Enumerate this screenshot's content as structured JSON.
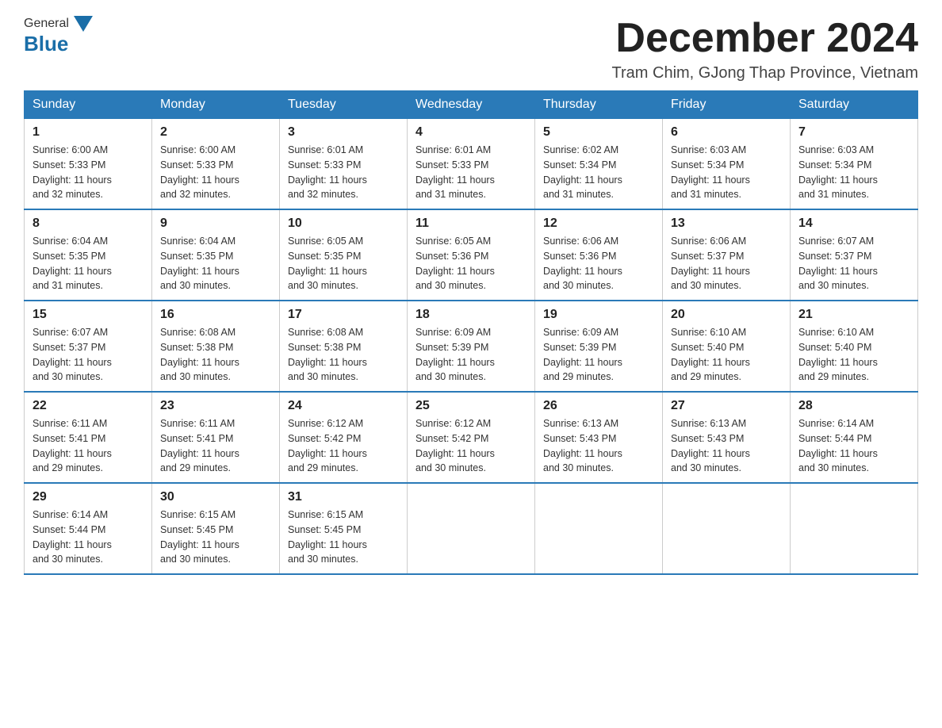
{
  "header": {
    "logo_general": "General",
    "logo_blue": "Blue",
    "month_title": "December 2024",
    "location": "Tram Chim, GJong Thap Province, Vietnam"
  },
  "days_of_week": [
    "Sunday",
    "Monday",
    "Tuesday",
    "Wednesday",
    "Thursday",
    "Friday",
    "Saturday"
  ],
  "weeks": [
    [
      {
        "day": "1",
        "sunrise": "6:00 AM",
        "sunset": "5:33 PM",
        "daylight": "11 hours and 32 minutes."
      },
      {
        "day": "2",
        "sunrise": "6:00 AM",
        "sunset": "5:33 PM",
        "daylight": "11 hours and 32 minutes."
      },
      {
        "day": "3",
        "sunrise": "6:01 AM",
        "sunset": "5:33 PM",
        "daylight": "11 hours and 32 minutes."
      },
      {
        "day": "4",
        "sunrise": "6:01 AM",
        "sunset": "5:33 PM",
        "daylight": "11 hours and 31 minutes."
      },
      {
        "day": "5",
        "sunrise": "6:02 AM",
        "sunset": "5:34 PM",
        "daylight": "11 hours and 31 minutes."
      },
      {
        "day": "6",
        "sunrise": "6:03 AM",
        "sunset": "5:34 PM",
        "daylight": "11 hours and 31 minutes."
      },
      {
        "day": "7",
        "sunrise": "6:03 AM",
        "sunset": "5:34 PM",
        "daylight": "11 hours and 31 minutes."
      }
    ],
    [
      {
        "day": "8",
        "sunrise": "6:04 AM",
        "sunset": "5:35 PM",
        "daylight": "11 hours and 31 minutes."
      },
      {
        "day": "9",
        "sunrise": "6:04 AM",
        "sunset": "5:35 PM",
        "daylight": "11 hours and 30 minutes."
      },
      {
        "day": "10",
        "sunrise": "6:05 AM",
        "sunset": "5:35 PM",
        "daylight": "11 hours and 30 minutes."
      },
      {
        "day": "11",
        "sunrise": "6:05 AM",
        "sunset": "5:36 PM",
        "daylight": "11 hours and 30 minutes."
      },
      {
        "day": "12",
        "sunrise": "6:06 AM",
        "sunset": "5:36 PM",
        "daylight": "11 hours and 30 minutes."
      },
      {
        "day": "13",
        "sunrise": "6:06 AM",
        "sunset": "5:37 PM",
        "daylight": "11 hours and 30 minutes."
      },
      {
        "day": "14",
        "sunrise": "6:07 AM",
        "sunset": "5:37 PM",
        "daylight": "11 hours and 30 minutes."
      }
    ],
    [
      {
        "day": "15",
        "sunrise": "6:07 AM",
        "sunset": "5:37 PM",
        "daylight": "11 hours and 30 minutes."
      },
      {
        "day": "16",
        "sunrise": "6:08 AM",
        "sunset": "5:38 PM",
        "daylight": "11 hours and 30 minutes."
      },
      {
        "day": "17",
        "sunrise": "6:08 AM",
        "sunset": "5:38 PM",
        "daylight": "11 hours and 30 minutes."
      },
      {
        "day": "18",
        "sunrise": "6:09 AM",
        "sunset": "5:39 PM",
        "daylight": "11 hours and 30 minutes."
      },
      {
        "day": "19",
        "sunrise": "6:09 AM",
        "sunset": "5:39 PM",
        "daylight": "11 hours and 29 minutes."
      },
      {
        "day": "20",
        "sunrise": "6:10 AM",
        "sunset": "5:40 PM",
        "daylight": "11 hours and 29 minutes."
      },
      {
        "day": "21",
        "sunrise": "6:10 AM",
        "sunset": "5:40 PM",
        "daylight": "11 hours and 29 minutes."
      }
    ],
    [
      {
        "day": "22",
        "sunrise": "6:11 AM",
        "sunset": "5:41 PM",
        "daylight": "11 hours and 29 minutes."
      },
      {
        "day": "23",
        "sunrise": "6:11 AM",
        "sunset": "5:41 PM",
        "daylight": "11 hours and 29 minutes."
      },
      {
        "day": "24",
        "sunrise": "6:12 AM",
        "sunset": "5:42 PM",
        "daylight": "11 hours and 29 minutes."
      },
      {
        "day": "25",
        "sunrise": "6:12 AM",
        "sunset": "5:42 PM",
        "daylight": "11 hours and 30 minutes."
      },
      {
        "day": "26",
        "sunrise": "6:13 AM",
        "sunset": "5:43 PM",
        "daylight": "11 hours and 30 minutes."
      },
      {
        "day": "27",
        "sunrise": "6:13 AM",
        "sunset": "5:43 PM",
        "daylight": "11 hours and 30 minutes."
      },
      {
        "day": "28",
        "sunrise": "6:14 AM",
        "sunset": "5:44 PM",
        "daylight": "11 hours and 30 minutes."
      }
    ],
    [
      {
        "day": "29",
        "sunrise": "6:14 AM",
        "sunset": "5:44 PM",
        "daylight": "11 hours and 30 minutes."
      },
      {
        "day": "30",
        "sunrise": "6:15 AM",
        "sunset": "5:45 PM",
        "daylight": "11 hours and 30 minutes."
      },
      {
        "day": "31",
        "sunrise": "6:15 AM",
        "sunset": "5:45 PM",
        "daylight": "11 hours and 30 minutes."
      },
      null,
      null,
      null,
      null
    ]
  ],
  "labels": {
    "sunrise": "Sunrise:",
    "sunset": "Sunset:",
    "daylight": "Daylight:"
  }
}
